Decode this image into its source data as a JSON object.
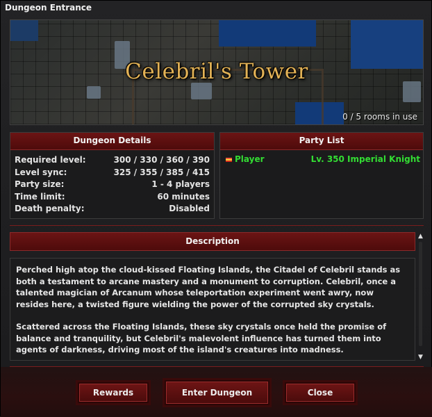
{
  "window": {
    "title": "Dungeon Entrance"
  },
  "banner": {
    "dungeon_name": "Celebril's Tower",
    "rooms_status": "0 / 5 rooms in use"
  },
  "details": {
    "header": "Dungeon Details",
    "rows": [
      {
        "label": "Required level:",
        "value": "300 / 330 / 360 / 390"
      },
      {
        "label": "Level sync:",
        "value": "325 / 355 / 385 / 415"
      },
      {
        "label": "Party size:",
        "value": "1 - 4 players"
      },
      {
        "label": "Time limit:",
        "value": "60 minutes"
      },
      {
        "label": "Death penalty:",
        "value": "Disabled"
      }
    ]
  },
  "party": {
    "header": "Party List",
    "members": [
      {
        "name": "Player",
        "info": "Lv. 350 Imperial Knight",
        "flag_icon": "flag-icon"
      }
    ]
  },
  "description": {
    "header": "Description",
    "paragraphs": [
      "Perched high atop the cloud-kissed Floating Islands, the Citadel of Celebril stands as both a testament to arcane mastery and a monument to corruption. Celebril, once a talented magician of Arcanum whose teleportation experiment went awry, now resides here, a twisted figure wielding the power of the corrupted sky crystals.",
      "Scattered across the Floating Islands, these sky crystals once held the promise of balance and tranquility, but Celebril's malevolent influence has turned them into agents of darkness, driving most of the island's creatures into madness."
    ]
  },
  "buttons": {
    "rewards": "Rewards",
    "enter": "Enter Dungeon",
    "close": "Close"
  },
  "colors": {
    "accent": "#6b1414",
    "party_text": "#33dd33",
    "title_gold": "#e2b256"
  }
}
